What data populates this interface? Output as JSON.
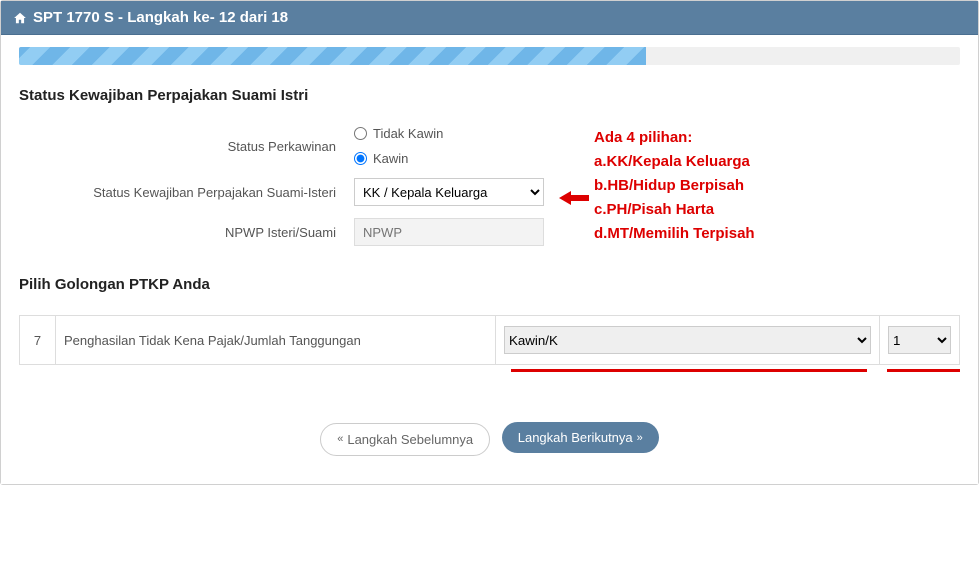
{
  "header": {
    "title": "SPT 1770 S - Langkah ke- 12 dari 18"
  },
  "progress": {
    "current": 12,
    "total": 18,
    "percent": 66.6
  },
  "section1": {
    "title": "Status Kewajiban Perpajakan Suami Istri",
    "status_perkawinan_label": "Status Perkawinan",
    "radio_tidak_kawin": "Tidak Kawin",
    "radio_kawin": "Kawin",
    "status_perkawinan_value": "kawin",
    "status_kewajiban_label": "Status Kewajiban Perpajakan Suami-Isteri",
    "status_kewajiban_value": "KK / Kepala Keluarga",
    "npwp_label": "NPWP Isteri/Suami",
    "npwp_placeholder": "NPWP",
    "npwp_value": ""
  },
  "annotation": {
    "heading": "Ada 4 pilihan:",
    "line_a": "a.KK/Kepala Keluarga",
    "line_b": "b.HB/Hidup Berpisah",
    "line_c": "c.PH/Pisah Harta",
    "line_d": "d.MT/Memilih Terpisah"
  },
  "section2": {
    "title": "Pilih Golongan PTKP Anda",
    "row_number": "7",
    "row_desc": "Penghasilan Tidak Kena Pajak/Jumlah Tanggungan",
    "golongan_value": "Kawin/K",
    "tanggungan_value": "1"
  },
  "nav": {
    "prev_label": "Langkah Sebelumnya",
    "next_label": "Langkah Berikutnya"
  }
}
